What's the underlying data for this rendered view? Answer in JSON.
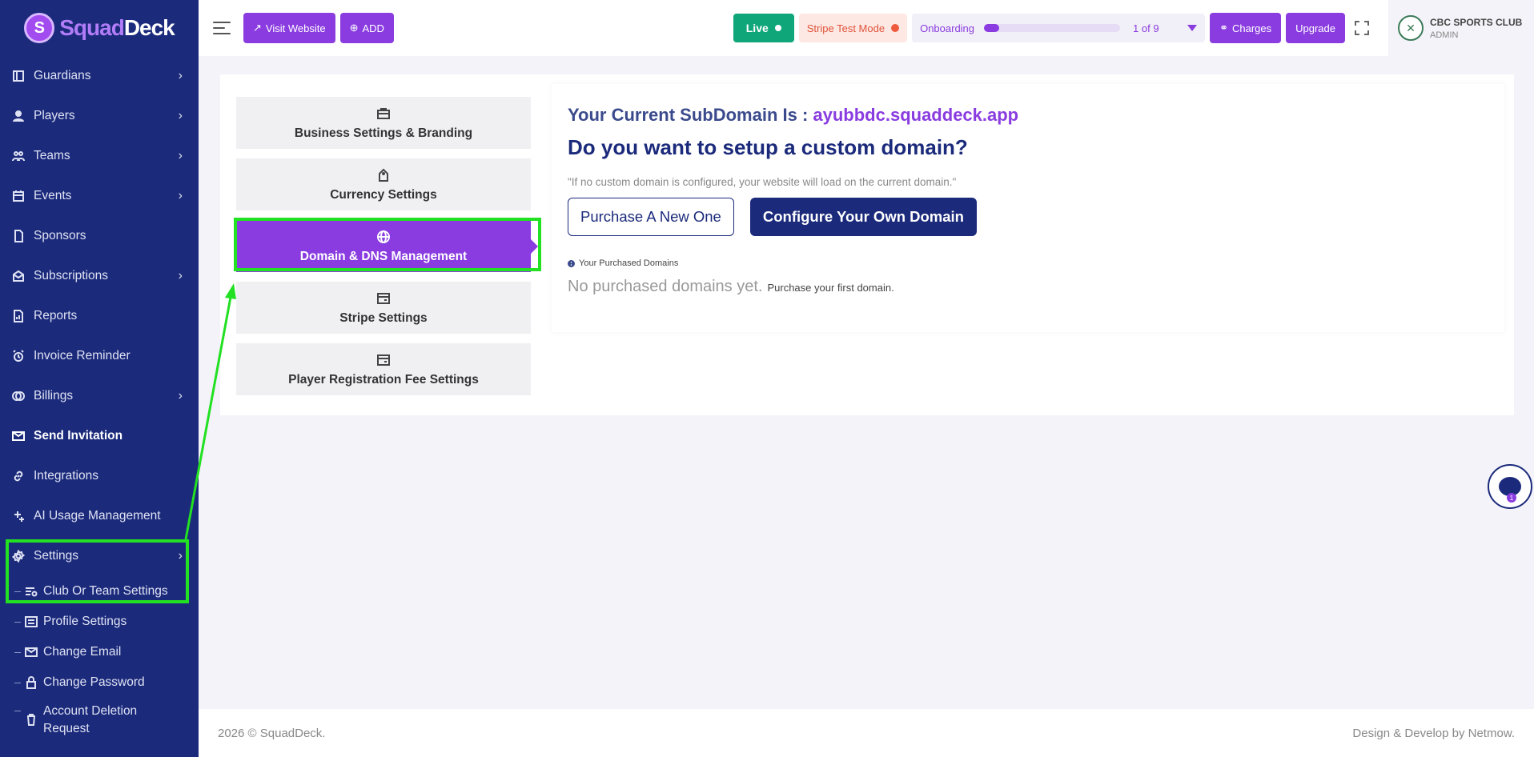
{
  "brand": {
    "squad": "Squad",
    "deck": "Deck",
    "mark": "S"
  },
  "sidebar": {
    "items": [
      {
        "label": "Guardians",
        "chevron": "›"
      },
      {
        "label": "Players",
        "chevron": "›"
      },
      {
        "label": "Teams",
        "chevron": "›"
      },
      {
        "label": "Events",
        "chevron": "›"
      },
      {
        "label": "Sponsors",
        "chevron": ""
      },
      {
        "label": "Subscriptions",
        "chevron": "›"
      },
      {
        "label": "Reports",
        "chevron": ""
      },
      {
        "label": "Invoice Reminder",
        "chevron": ""
      },
      {
        "label": "Billings",
        "chevron": "›"
      },
      {
        "label": "Send Invitation",
        "chevron": ""
      },
      {
        "label": "Integrations",
        "chevron": ""
      },
      {
        "label": "AI Usage Management",
        "chevron": ""
      },
      {
        "label": "Settings",
        "chevron": "›"
      }
    ],
    "sub_items": [
      {
        "label": "Club Or Team Settings"
      },
      {
        "label": "Profile Settings"
      },
      {
        "label": "Change Email"
      },
      {
        "label": "Change Password"
      },
      {
        "label": "Account Deletion Request"
      }
    ]
  },
  "topbar": {
    "visit_website": "Visit Website",
    "add": "ADD",
    "live": "Live",
    "stripe_mode": "Stripe Test Mode",
    "onboarding": "Onboarding",
    "onboarding_count": "1 of 9",
    "onboarding_progress": 0.11,
    "charges": "Charges",
    "upgrade": "Upgrade",
    "profile_name": "CBC SPORTS CLUB",
    "profile_role": "ADMIN"
  },
  "settings_tabs": [
    {
      "label": "Business Settings & Branding",
      "icon": "briefcase-icon"
    },
    {
      "label": "Currency Settings",
      "icon": "tag-icon"
    },
    {
      "label": "Domain & DNS Management",
      "icon": "globe-icon",
      "active": true
    },
    {
      "label": "Stripe Settings",
      "icon": "card-icon"
    },
    {
      "label": "Player Registration Fee Settings",
      "icon": "wallet-icon"
    }
  ],
  "domain": {
    "subdomain_label": "Your Current SubDomain Is : ",
    "subdomain_value": "ayubbdc.squaddeck.app",
    "heading": "Do you want to setup a custom domain?",
    "note": "\"If no custom domain is configured, your website will load on the current domain.\"",
    "purchase_btn": "Purchase A New One",
    "configure_btn": "Configure Your Own Domain",
    "purchased_label": "Your Purchased Domains",
    "empty_big": "No purchased domains yet.",
    "empty_small": "Purchase your first domain."
  },
  "chat": {
    "badge": "1"
  },
  "footer": {
    "left": "2026 © SquadDeck.",
    "right": "Design & Develop by Netmow."
  },
  "colors": {
    "sidebar": "#1b2a7b",
    "accent": "#8a3ce0",
    "live": "#0fa67a",
    "highlight": "#22e022"
  }
}
